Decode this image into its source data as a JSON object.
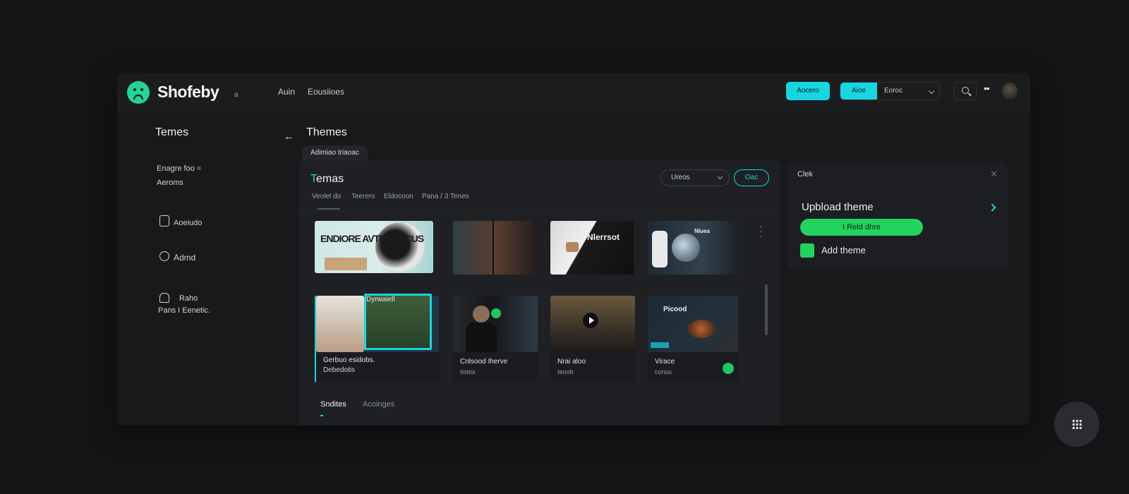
{
  "app": {
    "brand": "Shofeby",
    "brand_suffix": "a"
  },
  "topbar": {
    "nav": [
      "Auin",
      "Eousiioes"
    ],
    "primary_button": "Aocero",
    "segment_active": "Aioe",
    "segment_select": "Eoroc",
    "icons": [
      "search-icon",
      "more-icon",
      "avatar"
    ]
  },
  "sidebar": {
    "title": "Temes",
    "intro_line1": "Enagre foo =",
    "intro_line2": "Aeroms",
    "items": [
      {
        "icon": "cart-icon",
        "label": "Aoeiudo"
      },
      {
        "icon": "layers-icon",
        "label": "Admd"
      },
      {
        "icon": "home-icon",
        "label": "Raho",
        "sub": "Pans I Eenetic."
      }
    ]
  },
  "main": {
    "back_icon": "arrow-left-icon",
    "title": "Themes",
    "chip": "Adimiao triaoac",
    "panel": {
      "title_first": "T",
      "title_rest": "emas",
      "select_label": "Ureos",
      "outline_button": "Oac",
      "tabs": [
        "Veolel do",
        "Teerers",
        "Eldocoon",
        "Pana / 3 Tenes"
      ],
      "row1": [
        {
          "caption": "ENDIORE AVTENDOCUS"
        },
        {
          "caption": ""
        },
        {
          "caption": "Nlerrsot"
        },
        {
          "caption": "Nluea"
        }
      ],
      "cards": [
        {
          "name": "Gerbuo esidobs.",
          "sub": "Debedotis",
          "overlay": "Dyrwaiell"
        },
        {
          "name": "Cnlsood Iherve",
          "sub": "tiotos"
        },
        {
          "name": "Nrai aloo",
          "sub": "teoob"
        },
        {
          "name": "Virace",
          "sub": "conus",
          "overlay": "Picood"
        }
      ],
      "bottom_tabs": [
        "Sndites",
        "Acoinges"
      ]
    }
  },
  "right_card": {
    "label": "Clek",
    "title": "Upbload theme",
    "primary_button": "I Reld dhre",
    "add_label": "Add theme"
  },
  "colors": {
    "accent_cyan": "#16d6df",
    "accent_green": "#22d35d",
    "bg": "#141516"
  }
}
